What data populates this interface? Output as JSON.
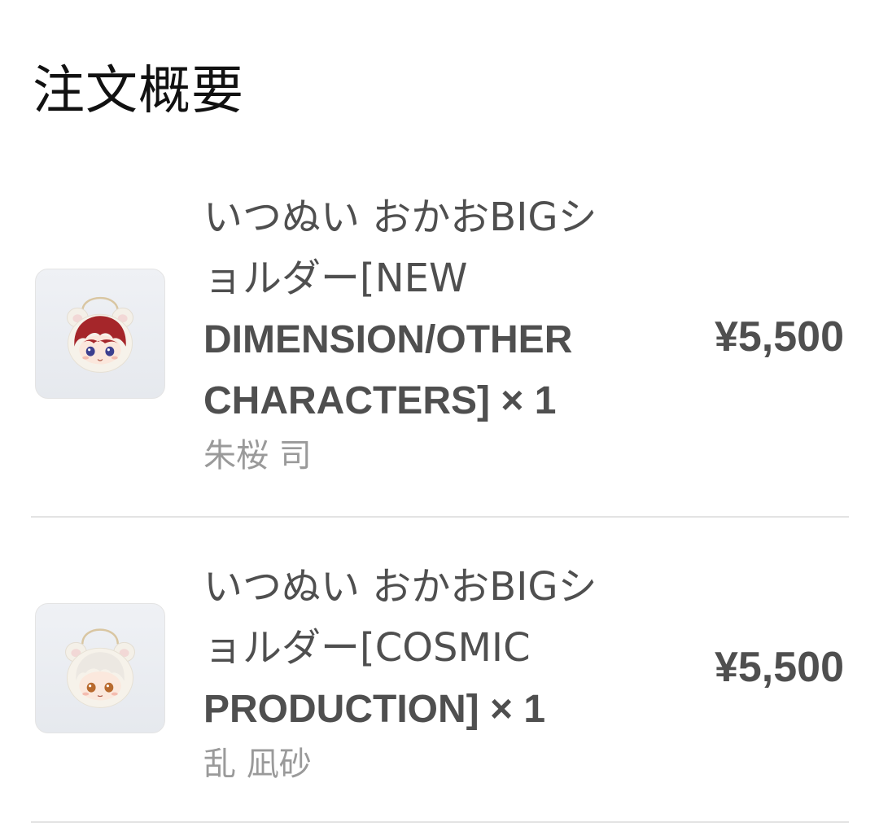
{
  "header": {
    "title": "注文概要"
  },
  "items": [
    {
      "name_lines": [
        "いつぬい おかおBIGシ",
        "ョルダー[NEW",
        "DIMENSION/OTHER",
        "CHARACTERS] × 1"
      ],
      "variant": "朱桜 司",
      "price": "¥5,500",
      "thumbnail": "plush-shoulder-bag-red-hair-icon"
    },
    {
      "name_lines": [
        "いつぬい おかおBIGシ",
        "ョルダー[COSMIC",
        "PRODUCTION] × 1"
      ],
      "variant": "乱 凪砂",
      "price": "¥5,500",
      "thumbnail": "plush-shoulder-bag-white-hair-icon"
    }
  ],
  "colors": {
    "title": "#111111",
    "text": "#4f4f4f",
    "muted": "#9a9a9a",
    "divider": "#e3e3e3"
  }
}
